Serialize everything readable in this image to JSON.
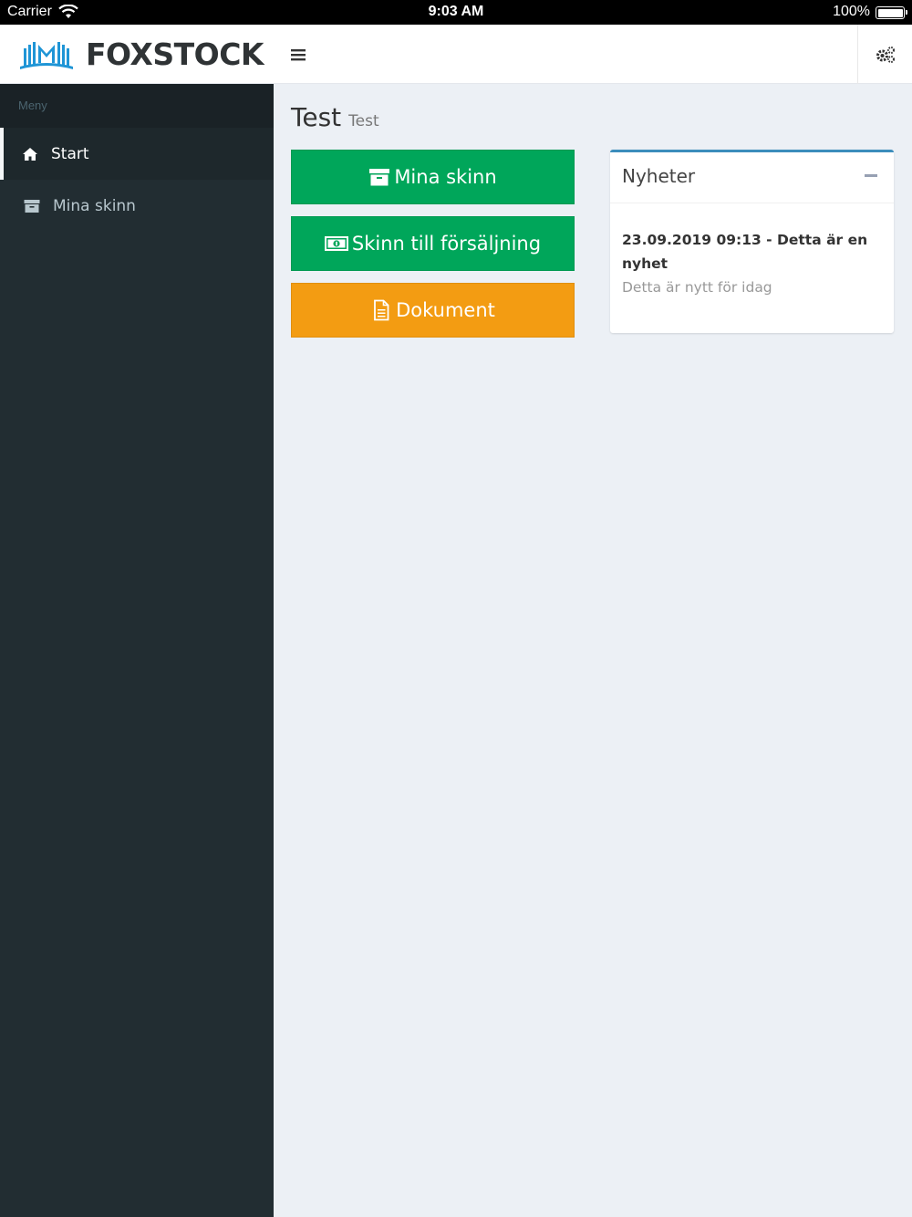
{
  "statusbar": {
    "carrier": "Carrier",
    "time": "9:03 AM",
    "battery": "100%"
  },
  "header": {
    "logo_text": "FOXSTOCK",
    "menu_icon": "hamburger-icon",
    "settings_icon": "gears-icon"
  },
  "sidebar": {
    "menu_header": "Meny",
    "items": [
      {
        "label": "Start",
        "icon": "home-icon",
        "active": true
      },
      {
        "label": "Mina skinn",
        "icon": "archive-icon",
        "active": false
      }
    ]
  },
  "main": {
    "title": "Test",
    "subtitle": "Test",
    "buttons": [
      {
        "label": "Mina skinn",
        "icon": "archive-icon",
        "color": "#00a65a"
      },
      {
        "label": "Skinn till försäljning",
        "icon": "money-icon",
        "color": "#00a65a"
      },
      {
        "label": "Dokument",
        "icon": "document-icon",
        "color": "#f39c12"
      }
    ],
    "news": {
      "title": "Nyheter",
      "items": [
        {
          "headline": "23.09.2019 09:13 - Detta är en nyhet",
          "text": "Detta är nytt för idag"
        }
      ]
    }
  },
  "colors": {
    "sidebar_bg": "#222d32",
    "content_bg": "#ecf0f5",
    "box_accent": "#3c8dbc",
    "green": "#00a65a",
    "orange": "#f39c12"
  }
}
